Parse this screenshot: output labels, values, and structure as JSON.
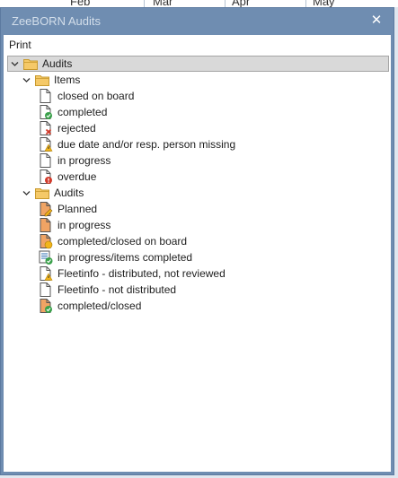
{
  "background": {
    "months": [
      "Feb",
      "Mar",
      "Apr",
      "May"
    ]
  },
  "window": {
    "title": "ZeeBORN Audits",
    "close_glyph": "✕"
  },
  "menu": {
    "print_label": "Print"
  },
  "tree": {
    "root": {
      "label": "Audits",
      "icon": "folder-icon",
      "expanded": true
    },
    "groups": [
      {
        "label": "Items",
        "icon": "folder-icon",
        "expanded": true,
        "children": [
          {
            "label": "closed on board",
            "icon": "document-icon"
          },
          {
            "label": "completed",
            "icon": "document-green-check-icon"
          },
          {
            "label": "rejected",
            "icon": "document-red-x-icon"
          },
          {
            "label": "due date and/or resp. person missing",
            "icon": "document-warning-icon"
          },
          {
            "label": "in progress",
            "icon": "document-icon"
          },
          {
            "label": "overdue",
            "icon": "document-red-alert-icon"
          }
        ]
      },
      {
        "label": "Audits",
        "icon": "folder-icon",
        "expanded": true,
        "children": [
          {
            "label": "Planned",
            "icon": "orange-document-pencil-icon"
          },
          {
            "label": "in progress",
            "icon": "orange-document-icon"
          },
          {
            "label": "completed/closed on board",
            "icon": "orange-document-yellow-circle-icon"
          },
          {
            "label": "in progress/items completed",
            "icon": "list-document-green-check-icon"
          },
          {
            "label": "Fleetinfo - distributed, not reviewed",
            "icon": "document-warning-icon"
          },
          {
            "label": "Fleetinfo - not distributed",
            "icon": "document-icon"
          },
          {
            "label": "completed/closed",
            "icon": "orange-document-green-check-icon"
          }
        ]
      }
    ]
  },
  "colors": {
    "titlebar": "#6f8db1",
    "folder": "#f5c968",
    "folder_stroke": "#c99a2e",
    "status_green": "#3aa04a",
    "status_red": "#d23a2a",
    "warning_yellow": "#f2b51a",
    "orange_doc": "#f0a464"
  }
}
